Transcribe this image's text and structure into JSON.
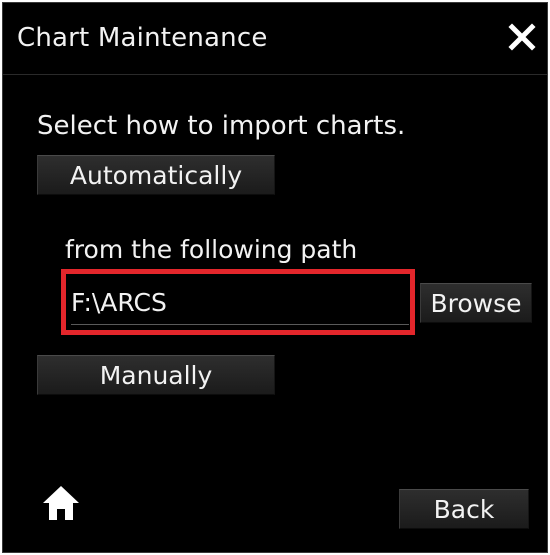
{
  "window": {
    "title": "Chart Maintenance",
    "close_icon": "close-icon"
  },
  "content": {
    "prompt": "Select how to import charts.",
    "automatic_label": "Automatically",
    "path_label": "from the following path",
    "path_value": "F:\\ARCS",
    "browse_label": "Browse",
    "manual_label": "Manually"
  },
  "footer": {
    "home_icon": "home-icon",
    "back_label": "Back"
  },
  "colors": {
    "background": "#000000",
    "text": "#f2f2f2",
    "highlight": "#e3262b",
    "button": "#242424"
  }
}
